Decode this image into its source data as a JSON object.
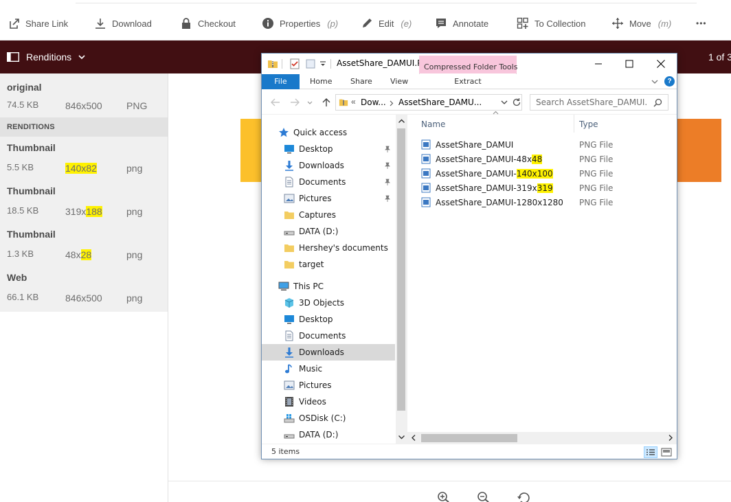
{
  "toolbar": {
    "share_link": "Share Link",
    "download": "Download",
    "checkout": "Checkout",
    "properties": "Properties",
    "properties_hint": "(p)",
    "edit": "Edit",
    "edit_hint": "(e)",
    "annotate": "Annotate",
    "to_collection": "To Collection",
    "move": "Move",
    "move_hint": "(m)",
    "more": "•••"
  },
  "rendbar": {
    "label": "Renditions",
    "pager": "1 of 3"
  },
  "renditions": {
    "original": {
      "title": "original",
      "size": "74.5 KB",
      "dims": "846x500",
      "format": "PNG"
    },
    "section_label": "RENDITIONS",
    "items": [
      {
        "title": "Thumbnail",
        "size": "5.5 KB",
        "dims": "140x82",
        "format": "png"
      },
      {
        "title": "Thumbnail",
        "size": "18.5 KB",
        "dims_prefix": "319x",
        "dims_hl": "188",
        "format": "png"
      },
      {
        "title": "Thumbnail",
        "size": "1.3 KB",
        "dims_prefix": "48x",
        "dims_hl": "28",
        "format": "png"
      },
      {
        "title": "Web",
        "size": "66.1 KB",
        "dims": "846x500",
        "format": "png"
      }
    ]
  },
  "explorer": {
    "title": "AssetShare_DAMUI.P...",
    "context_tab": "Compressed Folder Tools",
    "ribbon_tabs": {
      "file": "File",
      "home": "Home",
      "share": "Share",
      "view": "View",
      "extract": "Extract"
    },
    "address": {
      "overflow": "«",
      "crumb1": "Dow...",
      "crumb2": "AssetShare_DAMU..."
    },
    "search_placeholder": "Search AssetShare_DAMUI.PN...",
    "nav": {
      "quick_access": "Quick access",
      "qa_items": [
        "Desktop",
        "Downloads",
        "Documents",
        "Pictures",
        "Captures",
        "DATA (D:)",
        "Hershey's documents",
        "target"
      ],
      "this_pc": "This PC",
      "pc_items": [
        "3D Objects",
        "Desktop",
        "Documents",
        "Downloads",
        "Music",
        "Pictures",
        "Videos",
        "OSDisk (C:)",
        "DATA (D:)"
      ]
    },
    "columns": {
      "name": "Name",
      "type": "Type"
    },
    "files": [
      {
        "name": "AssetShare_DAMUI",
        "hl": "",
        "type": "PNG File"
      },
      {
        "name": "AssetShare_DAMUI-48x",
        "hl": "48",
        "type": "PNG File"
      },
      {
        "name": "AssetShare_DAMUI-",
        "hl": "140x100",
        "type": "PNG File"
      },
      {
        "name": "AssetShare_DAMUI-319x",
        "hl": "319",
        "type": "PNG File"
      },
      {
        "name": "AssetShare_DAMUI-1280x1280",
        "hl": "",
        "type": "PNG File"
      }
    ],
    "status": "5 items"
  },
  "colors": {
    "rendbar_bg": "#410f12",
    "highlight": "#fff200",
    "file_tab": "#1979ca",
    "context_tab": "#f8c6dc",
    "preview_left": "#fcc02b",
    "preview_right": "#ec7d27"
  }
}
